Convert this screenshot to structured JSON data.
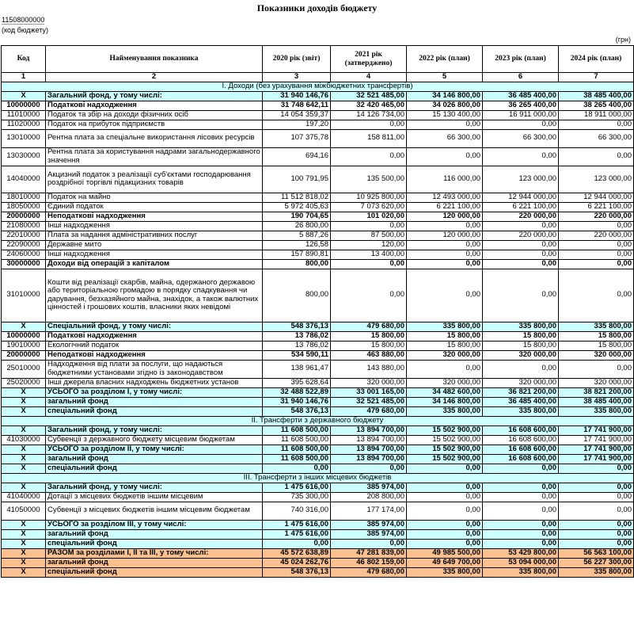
{
  "title": "Показники доходів бюджету",
  "budget_code": "11508000000",
  "budget_code_caption": "(код бюджету)",
  "unit": "(грн)",
  "columns": {
    "code": "Код",
    "name": "Найменування показника",
    "y2020": "2020 рік (звіт)",
    "y2021": "2021 рік (затверджено)",
    "y2022": "2022 рік (план)",
    "y2023": "2023 рік (план)",
    "y2024": "2024 рік (план)"
  },
  "column_numbers": [
    "1",
    "2",
    "3",
    "4",
    "5",
    "6",
    "7"
  ],
  "rows": [
    {
      "type": "section",
      "name": "I. Доходи (без урахування міжбюджетних трансфертів)"
    },
    {
      "type": "cyan",
      "bold": true,
      "code": "X",
      "name": "Загальний фонд, у тому числі:",
      "v": [
        "31 940 146,76",
        "32 521 485,00",
        "34 146 800,00",
        "36 485 400,00",
        "38 485 400,00"
      ]
    },
    {
      "bold": true,
      "code": "10000000",
      "name": "Податкові надходження",
      "v": [
        "31 748 642,11",
        "32 420 465,00",
        "34 026 800,00",
        "36 265 400,00",
        "38 265 400,00"
      ]
    },
    {
      "code": "11010000",
      "name": "Податок та збір на доходи фізичних осіб",
      "v": [
        "14 054 359,37",
        "14 126 734,00",
        "15 130 400,00",
        "16 911 000,00",
        "18 911 000,00"
      ]
    },
    {
      "code": "11020000",
      "name": "Податок на прибуток підприємств",
      "v": [
        "197,20",
        "0,00",
        "0,00",
        "0,00",
        "0,00"
      ]
    },
    {
      "code": "13010000",
      "name": "Рентна плата за спеціальне використання лісових ресурсів",
      "h": 2,
      "v": [
        "107 375,78",
        "158 811,00",
        "66 300,00",
        "66 300,00",
        "66 300,00"
      ]
    },
    {
      "code": "13030000",
      "name": "Рентна плата за користування надрами загальнодержавного значення",
      "h": 2,
      "v": [
        "694,16",
        "0,00",
        "0,00",
        "0,00",
        "0,00"
      ]
    },
    {
      "code": "14040000",
      "name": "Акцизний податок з реалізації суб'єктами господарювання роздрібної торгівлі підакцизних товарів",
      "h": 3,
      "v": [
        "100 791,95",
        "135 500,00",
        "116 000,00",
        "123 000,00",
        "123 000,00"
      ]
    },
    {
      "code": "18010000",
      "name": "Податок на майно",
      "v": [
        "11 512 818,02",
        "10 925 800,00",
        "12 493 000,00",
        "12 944 000,00",
        "12 944 000,00"
      ]
    },
    {
      "code": "18050000",
      "name": "Єдиний податок",
      "v": [
        "5 972 405,63",
        "7 073 620,00",
        "6 221 100,00",
        "6 221 100,00",
        "6 221 100,00"
      ]
    },
    {
      "bold": true,
      "code": "20000000",
      "name": "Неподаткові надходження",
      "v": [
        "190 704,65",
        "101 020,00",
        "120 000,00",
        "220 000,00",
        "220 000,00"
      ]
    },
    {
      "code": "21080000",
      "name": "Інші надходження",
      "v": [
        "26 800,00",
        "0,00",
        "0,00",
        "0,00",
        "0,00"
      ]
    },
    {
      "code": "22010000",
      "name": "Плата за надання адміністративних послуг",
      "v": [
        "5 887,26",
        "87 500,00",
        "120 000,00",
        "220 000,00",
        "220 000,00"
      ]
    },
    {
      "code": "22090000",
      "name": "Державне мито",
      "v": [
        "126,58",
        "120,00",
        "0,00",
        "0,00",
        "0,00"
      ]
    },
    {
      "code": "24060000",
      "name": "Інші надходження",
      "v": [
        "157 890,81",
        "13 400,00",
        "0,00",
        "0,00",
        "0,00"
      ]
    },
    {
      "bold": true,
      "code": "30000000",
      "name": "Доходи від операцій з капіталом",
      "v": [
        "800,00",
        "0,00",
        "0,00",
        "0,00",
        "0,00"
      ]
    },
    {
      "code": "31010000",
      "name": "Кошти від реалізації скарбів, майна, одержаного державою або територіальною громадою в порядку спадкування чи дарування, безхазяйного майна, знахідок, а також валютних цінностей і грошових коштів, власники яких невідомі",
      "h": 6,
      "v": [
        "800,00",
        "0,00",
        "0,00",
        "0,00",
        "0,00"
      ]
    },
    {
      "type": "cyan",
      "bold": true,
      "code": "X",
      "name": "Спеціальний фонд, у тому числі:",
      "v": [
        "548 376,13",
        "479 680,00",
        "335 800,00",
        "335 800,00",
        "335 800,00"
      ]
    },
    {
      "bold": true,
      "code": "10000000",
      "name": "Податкові надходження",
      "v": [
        "13 786,02",
        "15 800,00",
        "15 800,00",
        "15 800,00",
        "15 800,00"
      ]
    },
    {
      "code": "19010000",
      "name": "Екологічний податок",
      "v": [
        "13 786,02",
        "15 800,00",
        "15 800,00",
        "15 800,00",
        "15 800,00"
      ]
    },
    {
      "bold": true,
      "code": "20000000",
      "name": "Неподаткові надходження",
      "v": [
        "534 590,11",
        "463 880,00",
        "320 000,00",
        "320 000,00",
        "320 000,00"
      ]
    },
    {
      "code": "25010000",
      "name": "Надходження від плати за послуги, що надаються бюджетними установами згідно із законодавством",
      "h": 2,
      "v": [
        "138 961,47",
        "143 880,00",
        "0,00",
        "0,00",
        "0,00"
      ]
    },
    {
      "code": "25020000",
      "name": "Інші джерела власних надходжень бюджетних установ",
      "v": [
        "395 628,64",
        "320 000,00",
        "320 000,00",
        "320 000,00",
        "320 000,00"
      ]
    },
    {
      "type": "cyan",
      "bold": true,
      "code": "X",
      "name": "УСЬОГО за розділом I, у тому числі:",
      "v": [
        "32 488 522,89",
        "33 001 165,00",
        "34 482 600,00",
        "36 821 200,00",
        "38 821 200,00"
      ]
    },
    {
      "type": "cyan",
      "bold": true,
      "code": "X",
      "name": "загальний фонд",
      "v": [
        "31 940 146,76",
        "32 521 485,00",
        "34 146 800,00",
        "36 485 400,00",
        "38 485 400,00"
      ]
    },
    {
      "type": "cyan",
      "bold": true,
      "code": "X",
      "name": "спеціальний фонд",
      "v": [
        "548 376,13",
        "479 680,00",
        "335 800,00",
        "335 800,00",
        "335 800,00"
      ]
    },
    {
      "type": "section",
      "name": "II. Трансферти з державного бюджету"
    },
    {
      "type": "cyan",
      "bold": true,
      "code": "X",
      "name": "Загальний фонд, у тому числі:",
      "v": [
        "11 608 500,00",
        "13 894 700,00",
        "15 502 900,00",
        "16 608 600,00",
        "17 741 900,00"
      ]
    },
    {
      "code": "41030000",
      "name": "Субвенції з державного бюджету місцевим бюджетам",
      "v": [
        "11 608 500,00",
        "13 894 700,00",
        "15 502 900,00",
        "16 608 600,00",
        "17 741 900,00"
      ]
    },
    {
      "type": "cyan",
      "bold": true,
      "code": "X",
      "name": "УСЬОГО за розділом II, у тому числі:",
      "v": [
        "11 608 500,00",
        "13 894 700,00",
        "15 502 900,00",
        "16 608 600,00",
        "17 741 900,00"
      ]
    },
    {
      "type": "cyan",
      "bold": true,
      "code": "X",
      "name": "загальний фонд",
      "v": [
        "11 608 500,00",
        "13 894 700,00",
        "15 502 900,00",
        "16 608 600,00",
        "17 741 900,00"
      ]
    },
    {
      "type": "cyan",
      "bold": true,
      "code": "X",
      "name": "спеціальний фонд",
      "v": [
        "0,00",
        "0,00",
        "0,00",
        "0,00",
        "0,00"
      ]
    },
    {
      "type": "section",
      "name": "III. Трансферти з інших місцевих бюджетів"
    },
    {
      "type": "cyan",
      "bold": true,
      "code": "X",
      "name": "Загальний фонд, у тому числі:",
      "v": [
        "1 475 616,00",
        "385 974,00",
        "0,00",
        "0,00",
        "0,00"
      ]
    },
    {
      "code": "41040000",
      "name": "Дотації з місцевих бюджетів іншим місцевим",
      "v": [
        "735 300,00",
        "208 800,00",
        "0,00",
        "0,00",
        "0,00"
      ]
    },
    {
      "code": "41050000",
      "name": "Субвенції з місцевих бюджетів іншим місцевим бюджетам",
      "h": 2,
      "v": [
        "740 316,00",
        "177 174,00",
        "0,00",
        "0,00",
        "0,00"
      ]
    },
    {
      "type": "cyan",
      "bold": true,
      "code": "X",
      "name": "УСЬОГО за розділом III, у тому числі:",
      "v": [
        "1 475 616,00",
        "385 974,00",
        "0,00",
        "0,00",
        "0,00"
      ]
    },
    {
      "type": "cyan",
      "bold": true,
      "code": "X",
      "name": "загальний фонд",
      "v": [
        "1 475 616,00",
        "385 974,00",
        "0,00",
        "0,00",
        "0,00"
      ]
    },
    {
      "type": "cyan",
      "bold": true,
      "code": "X",
      "name": "спеціальний фонд",
      "v": [
        "0,00",
        "0,00",
        "0,00",
        "0,00",
        "0,00"
      ]
    },
    {
      "type": "orange",
      "bold": true,
      "code": "X",
      "name": "РАЗОМ за розділами I, II та III, у тому числі:",
      "v": [
        "45 572 638,89",
        "47 281 839,00",
        "49 985 500,00",
        "53 429 800,00",
        "56 563 100,00"
      ]
    },
    {
      "type": "orange",
      "bold": true,
      "code": "X",
      "name": "загальний фонд",
      "v": [
        "45 024 262,76",
        "46 802 159,00",
        "49 649 700,00",
        "53 094 000,00",
        "56 227 300,00"
      ]
    },
    {
      "type": "orange",
      "bold": true,
      "code": "X",
      "name": "спеціальний фонд",
      "v": [
        "548 376,13",
        "479 680,00",
        "335 800,00",
        "335 800,00",
        "335 800,00"
      ]
    }
  ]
}
